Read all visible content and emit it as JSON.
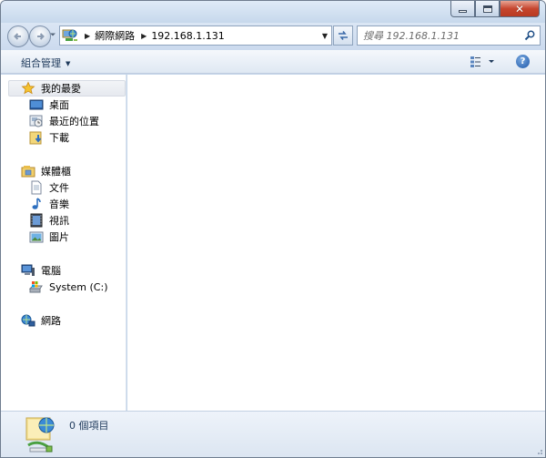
{
  "window": {
    "caption": {
      "minimize_icon": "minimize-icon",
      "maximize_icon": "maximize-icon",
      "close_label": "✕"
    }
  },
  "navbar": {
    "back_icon": "back-arrow-icon",
    "forward_icon": "forward-arrow-icon",
    "address": {
      "icon": "network-icon",
      "breadcrumbs": [
        "網際網路",
        "192.168.1.131"
      ]
    },
    "search": {
      "placeholder": "搜尋 192.168.1.131"
    }
  },
  "toolbar": {
    "organize_label": "組合管理"
  },
  "sidebar": {
    "favorites": {
      "label": "我的最愛",
      "items": [
        {
          "label": "桌面",
          "icon": "desktop-icon"
        },
        {
          "label": "最近的位置",
          "icon": "recent-places-icon"
        },
        {
          "label": "下載",
          "icon": "downloads-icon"
        }
      ]
    },
    "libraries": {
      "label": "媒體櫃",
      "items": [
        {
          "label": "文件",
          "icon": "documents-icon"
        },
        {
          "label": "音樂",
          "icon": "music-icon"
        },
        {
          "label": "視訊",
          "icon": "videos-icon"
        },
        {
          "label": "圖片",
          "icon": "pictures-icon"
        }
      ]
    },
    "computer": {
      "label": "電腦",
      "items": [
        {
          "label": "System (C:)",
          "icon": "drive-icon"
        }
      ]
    },
    "network": {
      "label": "網路"
    }
  },
  "details": {
    "count_text": "0 個項目"
  },
  "colors": {
    "accent": "#1e395b",
    "frame": "#c5d6ea",
    "close_button": "#c6462e"
  }
}
